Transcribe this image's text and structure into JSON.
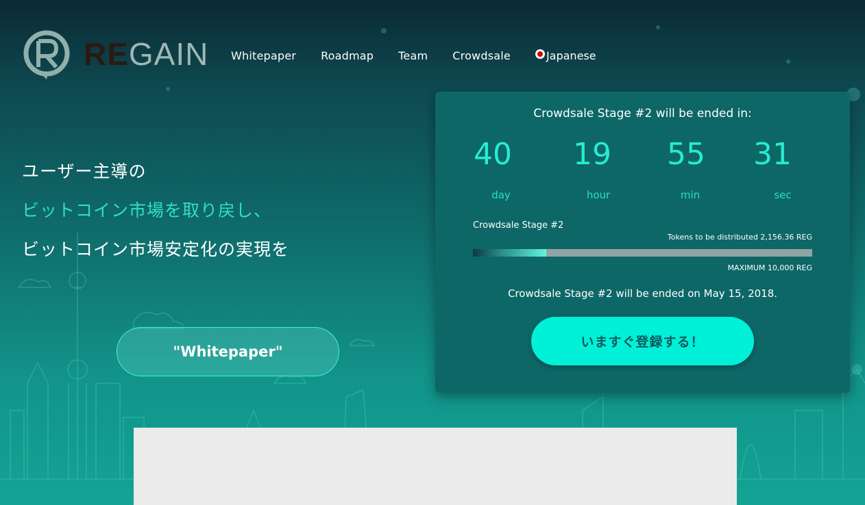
{
  "brand": {
    "logo_re": "RE",
    "logo_gain": "GAIN"
  },
  "nav": {
    "items": [
      "Whitepaper",
      "Roadmap",
      "Team",
      "Crowdsale"
    ],
    "language": "Japanese"
  },
  "hero": {
    "line1": "ユーザー主導の",
    "line2": "ビットコイン市場を取り戻し、",
    "line3": "ビットコイン市場安定化の実現を",
    "whitepaper_button": "\"Whitepaper\""
  },
  "crowdsale": {
    "title": "Crowdsale Stage #2 will be ended in:",
    "countdown": [
      {
        "value": "40",
        "unit": "day"
      },
      {
        "value": "19",
        "unit": "hour"
      },
      {
        "value": "55",
        "unit": "min"
      },
      {
        "value": "31",
        "unit": "sec"
      }
    ],
    "stage_label": "Crowdsale Stage #2",
    "tokens_distributed": "Tokens to be distributed 2,156.36 REG",
    "progress_percent": 21.6,
    "maximum": "MAXIMUM 10,000 REG",
    "end_date_text": "Crowdsale Stage #2 will be ended on May 15, 2018.",
    "register_button": "いますぐ登録する！"
  },
  "colors": {
    "accent": "#26ecd2",
    "button": "#00f0d8",
    "panel": "#0d6766",
    "flag_red": "#d40000"
  }
}
